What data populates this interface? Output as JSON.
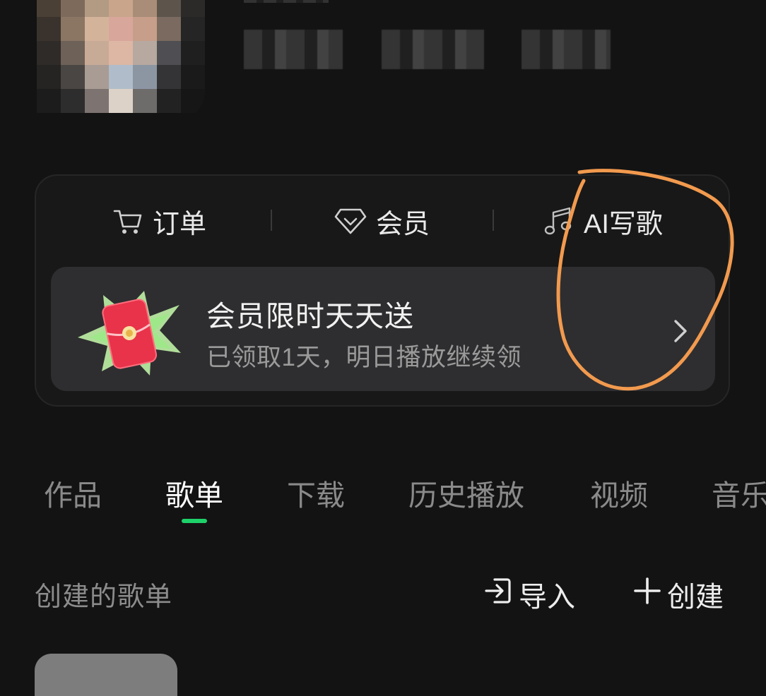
{
  "profile": {
    "name_redacted": true,
    "meta_redacted": true
  },
  "shortcuts": [
    {
      "label": "订单",
      "icon": "cart-icon"
    },
    {
      "label": "会员",
      "icon": "diamond-icon"
    },
    {
      "label": "AI写歌",
      "icon": "music-note-icon"
    }
  ],
  "promo": {
    "title": "会员限时天天送",
    "subtitle": "已领取1天，明日播放继续领",
    "icon": "red-envelope-icon"
  },
  "tabs": [
    {
      "label": "作品"
    },
    {
      "label": "歌单",
      "active": true
    },
    {
      "label": "下载"
    },
    {
      "label": "历史播放"
    },
    {
      "label": "视频"
    },
    {
      "label": "音乐"
    }
  ],
  "section": {
    "title": "创建的歌单",
    "import_label": "导入",
    "create_label": "创建"
  },
  "colors": {
    "background": "#131313",
    "card": "#181818",
    "promo": "#2e2e30",
    "accent_green": "#1ed26a",
    "annotation_orange": "#f29a4e",
    "envelope_red": "#e8334a"
  }
}
